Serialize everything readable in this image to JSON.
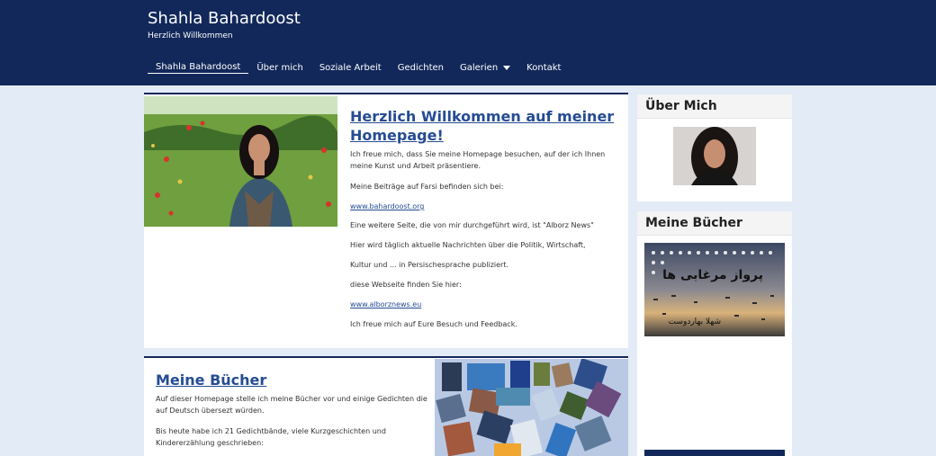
{
  "site": {
    "title": "Shahla Bahardoost",
    "subtitle": "Herzlich Willkommen"
  },
  "nav": [
    {
      "label": "Shahla Bahardoost"
    },
    {
      "label": "Über mich"
    },
    {
      "label": "Soziale Arbeit"
    },
    {
      "label": "Gedichten"
    },
    {
      "label": "Galerien"
    },
    {
      "label": "Kontakt"
    }
  ],
  "welcome": {
    "heading_line1": "Herzlich Willkommen auf meiner",
    "heading_line2": "Homepage! ",
    "p1_line1": "Ich freue mich, dass Sie meine Homepage besuchen, auf der ich Ihnen",
    "p1_line2": "meine Kunst und Arbeit präsentiere.",
    "p2": "Meine Beiträge auf Farsi befinden sich bei:",
    "link1": "www.bahardoost.org",
    "p3": "Eine weitere Seite, die von mir durchgeführt wird, ist \"Alborz News\"",
    "p4": "Hier wird täglich aktuelle Nachrichten über die Politik, Wirtschaft,",
    "p5": "Kultur und ... in Persischesprache publiziert.",
    "p6": "diese Webseite finden Sie hier:",
    "link2": "www.alborznews.eu",
    "p7": "Ich freue mich auf Eure Besuch und Feedback."
  },
  "books_section": {
    "heading": "Meine Bücher",
    "p1_line1": "Auf dieser Homepage stelle ich meine Bücher vor und einige Gedichten die",
    "p1_line2": "auf Deutsch übersezt würden.",
    "p2_line1": "Bis heute habe ich 21 Gedichtbände, viele Kurzgeschichten und",
    "p2_line2": "Kindererzählung geschrieben:"
  },
  "sidebar": {
    "about_title": "Über Mich",
    "books_title": "Meine Bücher",
    "book_cover_title": "پرواز مرغابی ها",
    "book_cover_author": "شهلا بهاردوست"
  },
  "colors": {
    "header_bg": "#12285a",
    "page_bg": "#e3ebf7",
    "link": "#254c93"
  }
}
